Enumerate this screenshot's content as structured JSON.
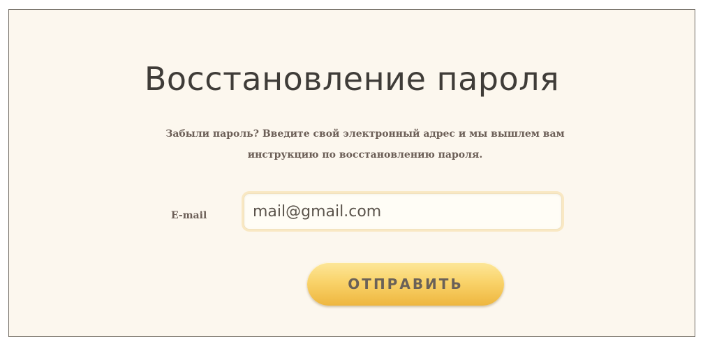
{
  "page": {
    "title": "Восстановление пароля",
    "description_line1": "Забыли пароль? Введите свой электронный адрес и мы вышлем вам",
    "description_line2": "инструкцию по восстановлению пароля."
  },
  "form": {
    "email_label": "E-mail",
    "email_value": "mail@gmail.com",
    "submit_label": "ОТПРАВИТЬ"
  },
  "colors": {
    "background": "#fcf7ee",
    "button": "#f9d36a",
    "text": "#3f3c38"
  }
}
